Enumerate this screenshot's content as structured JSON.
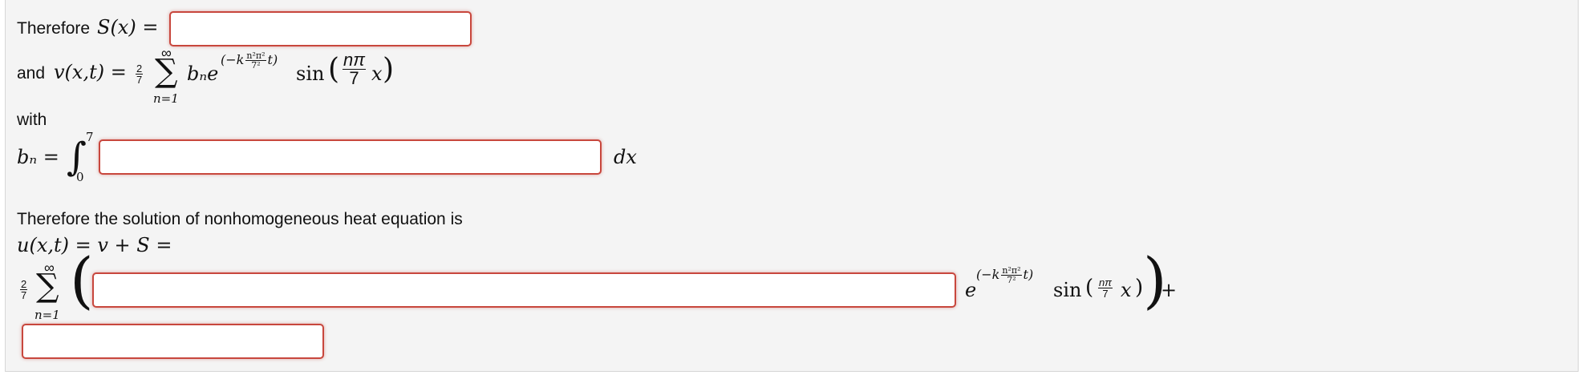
{
  "line1": {
    "label": "Therefore",
    "expr": "S(x) =",
    "input_value": ""
  },
  "line2": {
    "label": "and",
    "lhs": "v(x,t) =",
    "coef_num": "2",
    "coef_den": "7",
    "sum_top": "∞",
    "sum_bottom": "n=1",
    "term": "bₙe",
    "exp_prefix": "−k",
    "exp_num": "n²π²",
    "exp_den": "7²",
    "exp_suffix": "t",
    "sin": "sin",
    "sin_num": "nπ",
    "sin_den": "7",
    "sin_var": "x"
  },
  "with_label": "with",
  "bn": {
    "lhs": "bₙ =",
    "int_upper": "7",
    "int_lower": "0",
    "input_value": "",
    "dx": "dx"
  },
  "solution": {
    "sentence": "Therefore the solution of nonhomogeneous heat equation is",
    "expr": "u(x,t) = v + S =",
    "coef_num": "2",
    "coef_den": "7",
    "sum_top": "∞",
    "sum_bottom": "n=1",
    "input_value": "",
    "e": "e",
    "exp_prefix": "−k",
    "exp_num": "n²π²",
    "exp_den": "7²",
    "exp_suffix": "t",
    "sin": "sin",
    "sin_num": "nπ",
    "sin_den": "7",
    "sin_var": "x",
    "plus": "+",
    "last_input_value": ""
  }
}
